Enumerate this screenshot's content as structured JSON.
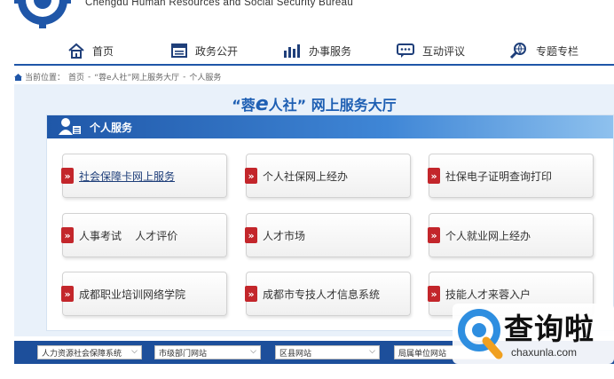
{
  "header": {
    "bureau_name": "Chengdu Human Resources and Social Security Bureau"
  },
  "nav": {
    "items": [
      {
        "label": "首页",
        "icon": "home-icon"
      },
      {
        "label": "政务公开",
        "icon": "document-icon"
      },
      {
        "label": "办事服务",
        "icon": "bar-chart-icon"
      },
      {
        "label": "互动评议",
        "icon": "chat-icon"
      },
      {
        "label": "专题专栏",
        "icon": "search-globe-icon"
      }
    ]
  },
  "breadcrumb": {
    "prefix": "当前位置：",
    "home": "首页",
    "sep1": "-",
    "hall": "“蓉e人社”网上服务大厅",
    "sep2": "-",
    "current": "个人服务"
  },
  "hall": {
    "title_prefix": "“蓉",
    "title_e": "e",
    "title_suffix": "人社” 网上服务大厅",
    "section_label": "个人服务"
  },
  "services": [
    {
      "label": "社会保障卡网上服务"
    },
    {
      "label": "个人社保网上经办"
    },
    {
      "label": "社保电子证明查询打印"
    },
    {
      "label": "人事考试    人才评价"
    },
    {
      "label": "人才市场"
    },
    {
      "label": "个人就业网上经办"
    },
    {
      "label": "成都职业培训网络学院"
    },
    {
      "label": "成都市专技人才信息系统"
    },
    {
      "label": "技能人才来蓉入户"
    }
  ],
  "footer": {
    "selects": [
      {
        "label": "人力资源社会保障系统"
      },
      {
        "label": "市级部门网站"
      },
      {
        "label": "区县网站"
      },
      {
        "label": "局属单位网站"
      }
    ]
  },
  "watermark": {
    "text": "查询啦",
    "url": "chaxunla.com"
  },
  "colors": {
    "brand_blue": "#1f56a8",
    "arrow_red": "#c3262b",
    "panel_bg": "#e9f1fa"
  }
}
